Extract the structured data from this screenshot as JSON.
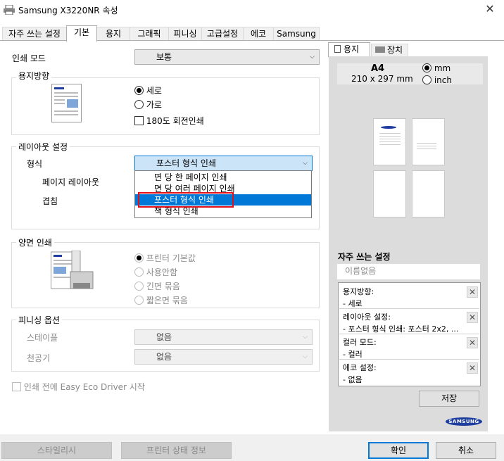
{
  "window": {
    "title": "Samsung X3220NR 속성",
    "close": "✕"
  },
  "tabs": [
    "자주 쓰는 설정",
    "기본",
    "용지",
    "그래픽",
    "피니싱",
    "고급설정",
    "에코",
    "Samsung"
  ],
  "basic": {
    "print_mode_label": "인쇄 모드",
    "print_mode_value": "보통",
    "orientation_group": "용지방향",
    "portrait": "세로",
    "landscape": "가로",
    "rotate180": "180도 회전인쇄",
    "layout_group": "레이아웃 설정",
    "type_label": "형식",
    "type_value": "포스터 형식 인쇄",
    "page_layout_label": "페이지 레이아웃",
    "overlap_label": "겹침",
    "layout_options": [
      "면 당 한 페이지 인쇄",
      "면 당 여러 페이지 인쇄",
      "포스터 형식 인쇄",
      "책 형식 인쇄"
    ],
    "duplex_group": "양면 인쇄",
    "duplex_options": [
      "프린터 기본값",
      "사용안함",
      "긴면 묶음",
      "짧은면 묶음"
    ],
    "finishing_group": "피니싱 옵션",
    "staple_label": "스테이플",
    "staple_value": "없음",
    "punch_label": "천공기",
    "punch_value": "없음",
    "eco_check": "인쇄 전에 Easy Eco Driver 시작"
  },
  "preview": {
    "tab_paper": "용지",
    "tab_device": "장치",
    "paper_size": "A4",
    "paper_dims": "210 x 297 mm",
    "unit_mm": "mm",
    "unit_inch": "inch",
    "brand": "SAMSUNG"
  },
  "favorites": {
    "title": "자주 쓰는 설정",
    "name_placeholder": "이름없음",
    "items": [
      {
        "key": "용지방향:",
        "value": "- 세로"
      },
      {
        "key": "레이아웃 설정:",
        "value": "- 포스터 형식 인쇄: 포스터 2x2, ..."
      },
      {
        "key": "컬러 모드:",
        "value": "- 컬러"
      },
      {
        "key": "에코 설정:",
        "value": "- 없음"
      }
    ],
    "save": "저장"
  },
  "footer": {
    "styles": "스타일리시",
    "printer_status": "프린터 상태 정보",
    "ok": "확인",
    "cancel": "취소"
  }
}
